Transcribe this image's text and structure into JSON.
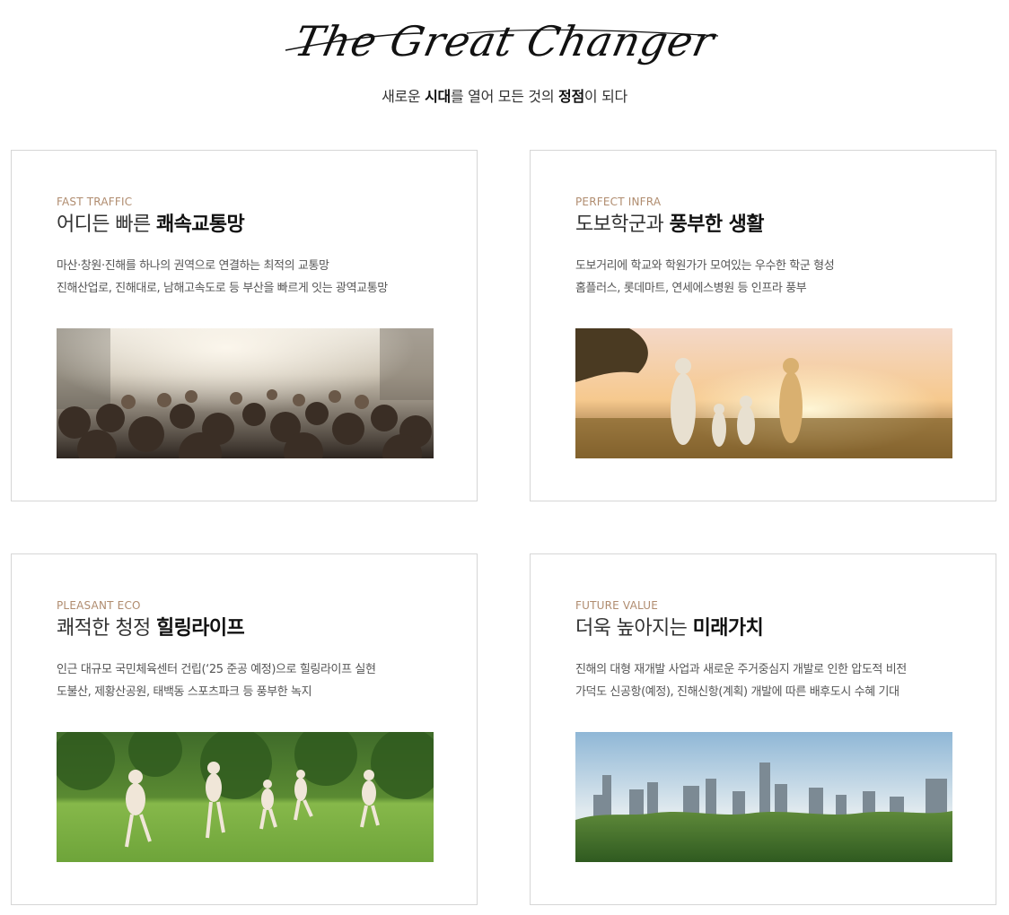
{
  "header": {
    "script_title": "The Great Changer",
    "subtitle_parts": [
      "새로운 ",
      "시대",
      "를 열어 모든 것의 ",
      "정점",
      "이 되다"
    ]
  },
  "cards": [
    {
      "kicker": "FAST TRAFFIC",
      "heading_light": "어디든 빠른 ",
      "heading_bold": "쾌속교통망",
      "lines": [
        "마산·창원·진해를 하나의 권역으로 연결하는 최적의 교통망",
        "진해산업로, 진해대로, 남해고속도로 등 부산을 빠르게 잇는 광역교통망"
      ],
      "image": "crowd-street-photo"
    },
    {
      "kicker": "PERFECT INFRA",
      "heading_light": "도보학군과 ",
      "heading_bold": "풍부한 생활",
      "lines": [
        "도보거리에 학교와 학원가가 모여있는 우수한 학군 형성",
        "홈플러스, 롯데마트, 연세에스병원 등 인프라 풍부"
      ],
      "image": "family-field-sunset-photo"
    },
    {
      "kicker": "PLEASANT ECO",
      "heading_light": "쾌적한 청정 ",
      "heading_bold": "힐링라이프",
      "lines": [
        "인근 대규모 국민체육센터 건립(‘25 준공 예정)으로 힐링라이프 실현",
        "도불산, 제황산공원, 태백동 스포츠파크 등 풍부한 녹지"
      ],
      "image": "children-park-photo"
    },
    {
      "kicker": "FUTURE VALUE",
      "heading_light": "더욱 높아지는 ",
      "heading_bold": "미래가치",
      "lines": [
        "진해의 대형 재개발 사업과 새로운 주거중심지 개발로 인한 압도적 비전",
        "가덕도 신공항(예정), 진해신항(계획) 개발에 따른 배후도시 수혜 기대"
      ],
      "image": "city-skyline-forest-photo"
    }
  ]
}
